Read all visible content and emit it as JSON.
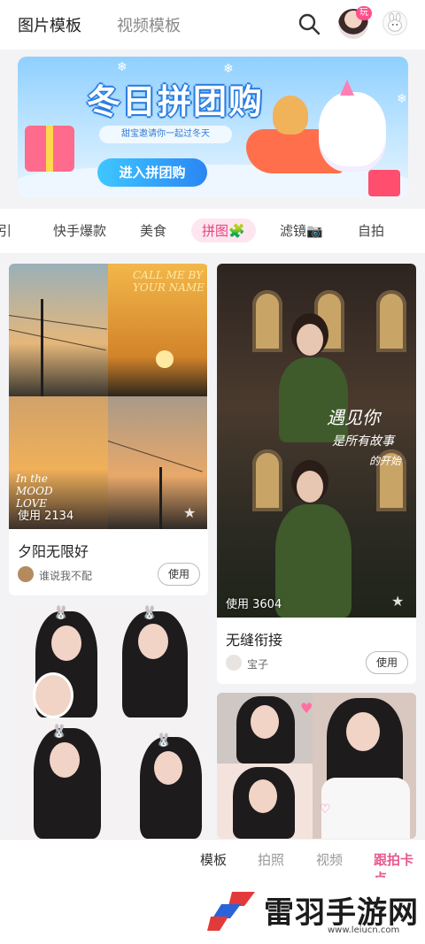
{
  "header": {
    "tabs": [
      {
        "label": "图片模板"
      },
      {
        "label": "视频模板"
      }
    ],
    "avatar_badge": "玩",
    "icons": {
      "search": "search-icon",
      "avatar": "user-avatar",
      "mascot": "mascot-icon"
    }
  },
  "banner": {
    "title": "冬日拼团购",
    "subtitle": "甜宝邀请你一起过冬天",
    "button_label": "进入拼团购"
  },
  "categories": [
    {
      "label": "引"
    },
    {
      "label": "快手爆款"
    },
    {
      "label": "美食"
    },
    {
      "label": "拼图🧩"
    },
    {
      "label": "滤镜📷"
    },
    {
      "label": "自拍"
    }
  ],
  "active_category_index": 3,
  "cards": [
    {
      "usage": "使用 2134",
      "title": "夕阳无限好",
      "author": "谁说我不配",
      "use_label": "使用",
      "art_text": [
        "CALL ME BY YOUR NAME",
        "In the MOOD LOVE"
      ]
    },
    {
      "usage": "使用 3604",
      "title": "无缝衔接",
      "author": "宝子",
      "use_label": "使用",
      "art_text": [
        "遇见你",
        "是所有故事",
        "的开始"
      ]
    },
    {
      "usage": "",
      "title": "",
      "author": "",
      "use_label": ""
    },
    {
      "usage": "",
      "title": "",
      "author": "",
      "use_label": ""
    }
  ],
  "bottom_nav": [
    {
      "label": "模板"
    },
    {
      "label": "拍照"
    },
    {
      "label": "视频"
    },
    {
      "label": "跟拍卡点"
    }
  ],
  "watermark": {
    "brand": "雷羽手游网",
    "url": "www.leiucn.com"
  },
  "colors": {
    "accent_pink": "#e9417d",
    "banner_blue": "#2a86f4"
  }
}
